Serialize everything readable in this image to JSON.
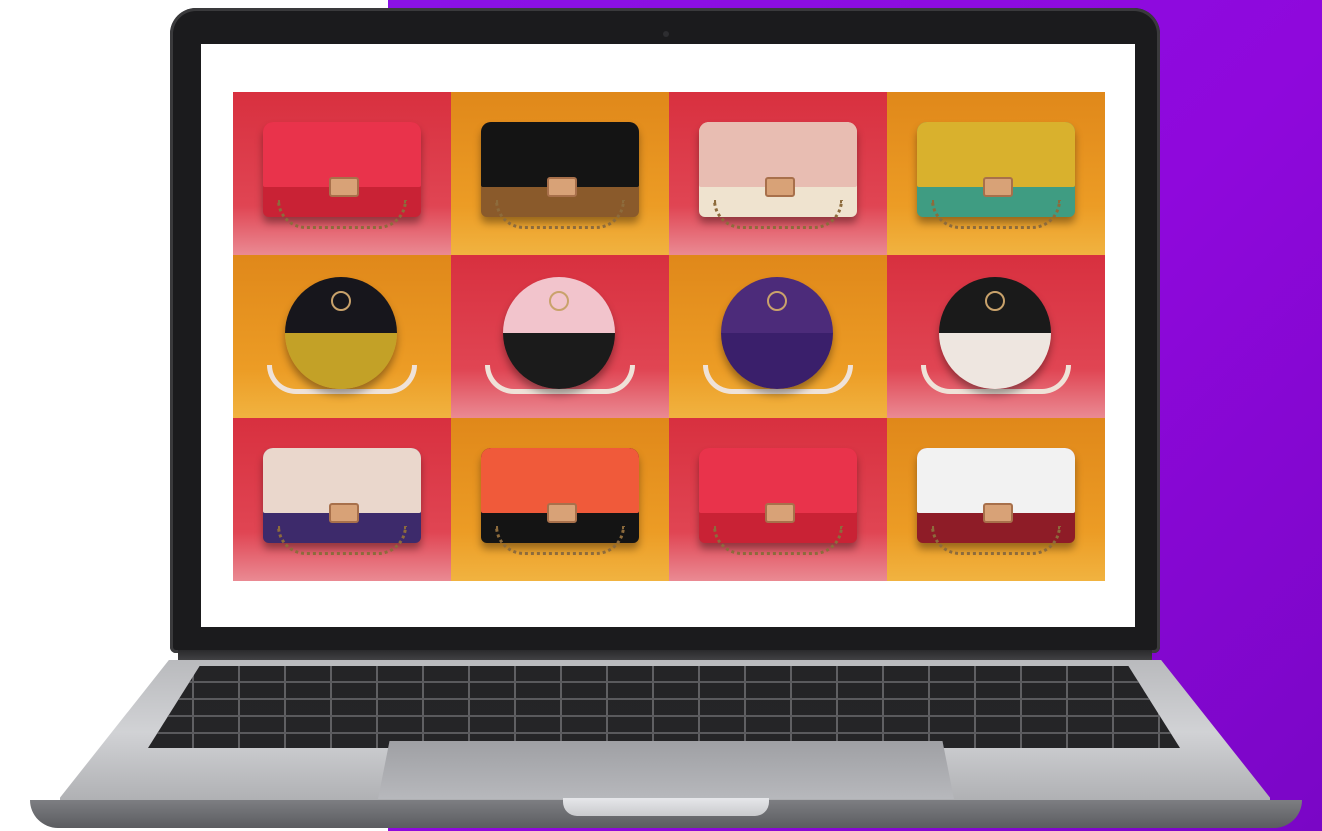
{
  "scene": {
    "background_color": "#ffffff",
    "accent_color": "#8a12e6",
    "device": "laptop"
  },
  "screen_content": {
    "tiles": [
      {
        "bg": "red",
        "bag": "clutch",
        "flap": "#e9334b",
        "body": "#c92235",
        "pattern": "floral"
      },
      {
        "bg": "orange",
        "bag": "clutch",
        "flap": "#141414",
        "body": "#8a5a2b",
        "pattern": "leopard"
      },
      {
        "bg": "red",
        "bag": "clutch",
        "flap": "#e8bdb2",
        "body": "#efe3cf",
        "pattern": "dots"
      },
      {
        "bg": "orange",
        "bag": "clutch",
        "flap": "#d9b12d",
        "body": "#3f9c82",
        "pattern": "hexagons"
      },
      {
        "bg": "orange",
        "bag": "round",
        "top": "#17161c",
        "body": "#c3a127",
        "pattern": "leaf"
      },
      {
        "bg": "red",
        "bag": "round",
        "top": "#f2c4cc",
        "body": "#1b1b1b",
        "pattern": "triangles"
      },
      {
        "bg": "orange",
        "bag": "round",
        "top": "#4c2b7a",
        "body": "#3a1f6b",
        "pattern": "lace"
      },
      {
        "bg": "red",
        "bag": "round",
        "top": "#1a1a1a",
        "body": "#eee6e0",
        "pattern": "mint"
      },
      {
        "bg": "red",
        "bag": "clutch",
        "flap": "#ead7cc",
        "body": "#3d2a6b",
        "pattern": "arches"
      },
      {
        "bg": "orange",
        "bag": "clutch",
        "flap": "#f05a3a",
        "body": "#141414",
        "pattern": "art"
      },
      {
        "bg": "red",
        "bag": "clutch",
        "flap": "#e9334b",
        "body": "#c92235",
        "pattern": "floral"
      },
      {
        "bg": "orange",
        "bag": "clutch",
        "flap": "#f2f2f2",
        "body": "#8e1c27",
        "pattern": "cubes"
      }
    ]
  }
}
